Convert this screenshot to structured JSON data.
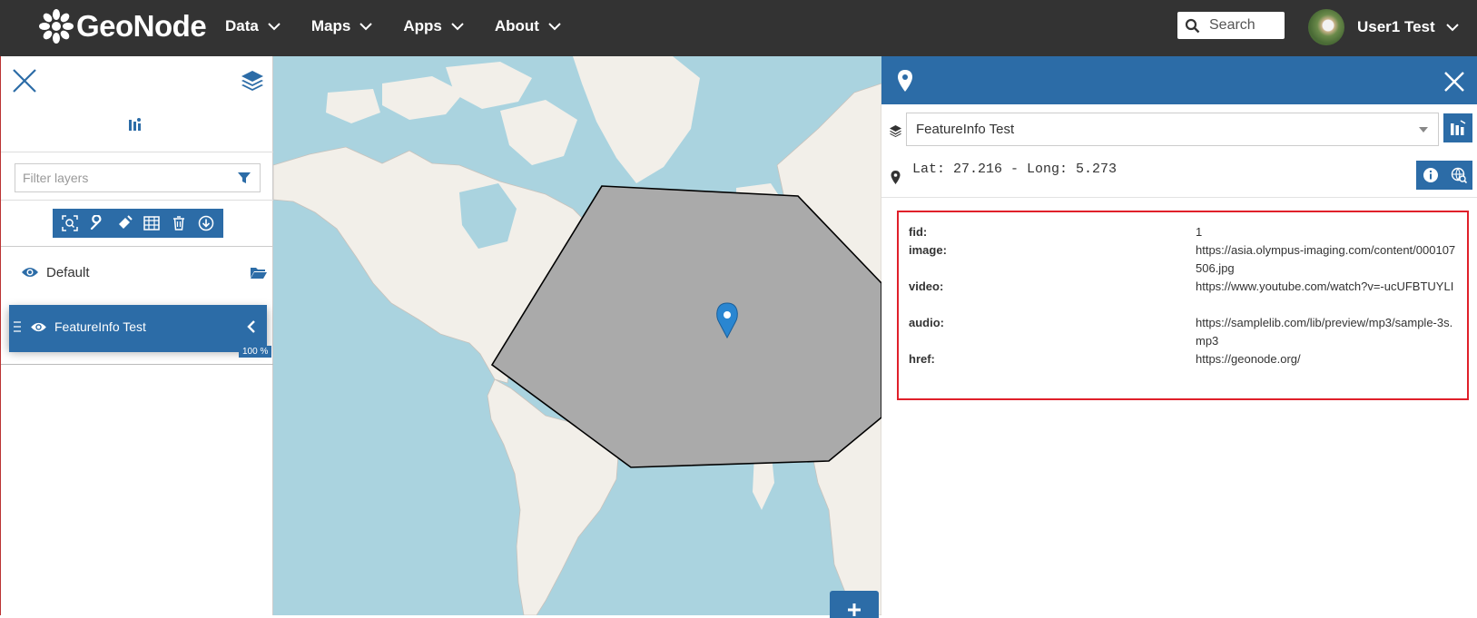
{
  "header": {
    "brand": "GeoNode",
    "nav": [
      {
        "label": "Data"
      },
      {
        "label": "Maps"
      },
      {
        "label": "Apps"
      },
      {
        "label": "About"
      }
    ],
    "search_placeholder": "Search",
    "user_name": "User1 Test"
  },
  "layers_panel": {
    "filter_placeholder": "Filter layers",
    "group_label": "Default",
    "layer_label": "FeatureInfo Test",
    "opacity_label": "100 %",
    "opacity": 1.0
  },
  "identify_panel": {
    "selected_layer": "FeatureInfo Test",
    "coordinates": "Lat: 27.216 - Long: 5.273",
    "properties": [
      {
        "key": "fid:",
        "value": "1"
      },
      {
        "key": "image:",
        "value": "https://asia.olympus-imaging.com/content/000107506.jpg"
      },
      {
        "key": "video:",
        "value": "https://www.youtube.com/watch?v=-ucUFBTUYLI"
      },
      {
        "key": "audio:",
        "value": "https://samplelib.com/lib/preview/mp3/sample-3s.mp3"
      },
      {
        "key": "href:",
        "value": "https://geonode.org/"
      }
    ]
  },
  "colors": {
    "topbar": "#333333",
    "primary": "#2c6ca7",
    "water": "#aad3df",
    "land": "#f2efe9",
    "polygon": "#aaaaaa",
    "highlight_border": "#e0202a"
  }
}
